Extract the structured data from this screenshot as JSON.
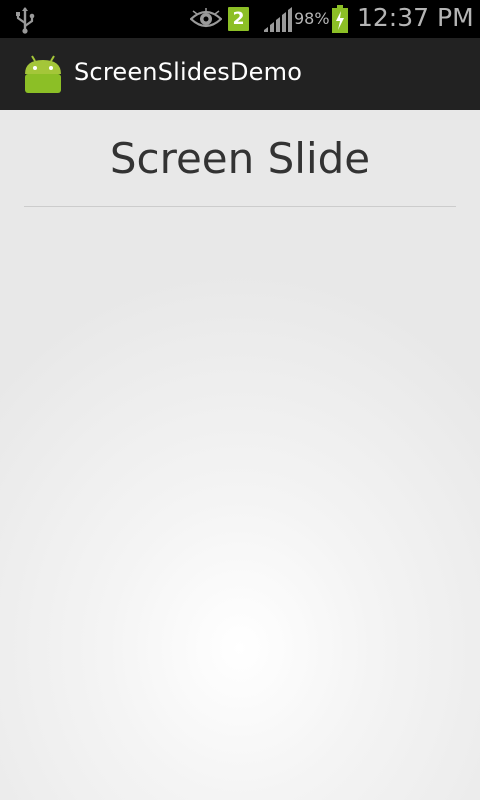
{
  "status_bar": {
    "notification_count": "2",
    "battery_percent": "98%",
    "time": "12:37 PM",
    "icons": [
      "usb-icon",
      "eye-icon",
      "signal-icon",
      "battery-charging-icon"
    ]
  },
  "action_bar": {
    "app_title": "ScreenSlidesDemo",
    "app_icon": "android-icon"
  },
  "content": {
    "slide_title": "Screen Slide"
  },
  "colors": {
    "action_bar_bg": "#222222",
    "status_bar_bg": "#000000",
    "accent_green": "#8cbf26",
    "title_text": "#333333"
  }
}
